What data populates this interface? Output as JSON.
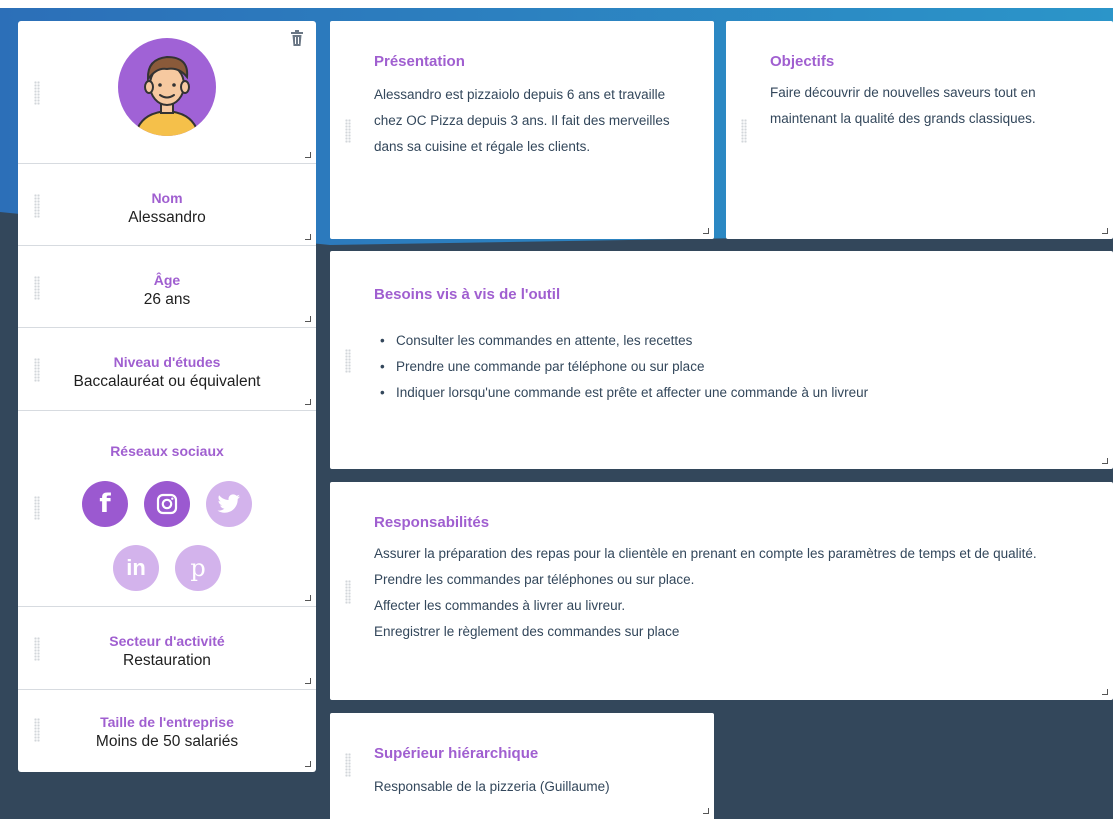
{
  "profile": {
    "name_label": "Nom",
    "name_value": "Alessandro",
    "age_label": "Âge",
    "age_value": "26 ans",
    "education_label": "Niveau d'études",
    "education_value": "Baccalauréat ou équivalent",
    "social_label": "Réseaux sociaux",
    "sector_label": "Secteur d'activité",
    "sector_value": "Restauration",
    "company_size_label": "Taille de l'entreprise",
    "company_size_value": "Moins de 50 salariés"
  },
  "social_icons": [
    {
      "name": "facebook-icon",
      "glyph": "f",
      "color": "#9b59d0"
    },
    {
      "name": "instagram-icon",
      "glyph": "",
      "color": "#9b59d0"
    },
    {
      "name": "twitter-icon",
      "glyph": "",
      "color": "#d3b3ec"
    },
    {
      "name": "linkedin-icon",
      "glyph": "in",
      "color": "#d3b3ec"
    },
    {
      "name": "pinterest-icon",
      "glyph": "p",
      "color": "#d3b3ec"
    }
  ],
  "presentation": {
    "title": "Présentation",
    "text": "Alessandro est pizzaiolo depuis 6 ans et travaille chez OC Pizza depuis 3 ans. Il fait des merveilles dans sa cuisine et régale les clients."
  },
  "objectives": {
    "title": "Objectifs",
    "text": "Faire découvrir de nouvelles saveurs tout en maintenant la qualité des grands classiques."
  },
  "needs": {
    "title": "Besoins vis à vis de l'outil",
    "items": [
      "Consulter les commandes en attente, les recettes",
      "Prendre une commande par téléphone ou sur place",
      "Indiquer lorsqu'une commande est prête et affecter une commande à un livreur"
    ]
  },
  "responsibilities": {
    "title": "Responsabilités",
    "lines": [
      "Assurer la préparation des repas pour la clientèle en prenant en compte les paramètres de temps et de qualité.",
      "Prendre les commandes par téléphones ou sur place.",
      "Affecter les commandes à livrer au livreur.",
      "Enregistrer le règlement des commandes sur place"
    ]
  },
  "superior": {
    "title": "Supérieur hiérarchique",
    "text": "Responsable de la pizzeria (Guillaume)"
  },
  "colors": {
    "accent": "#a05fd0",
    "background_dark": "#33475b",
    "background_blue": "#2f87c8"
  }
}
